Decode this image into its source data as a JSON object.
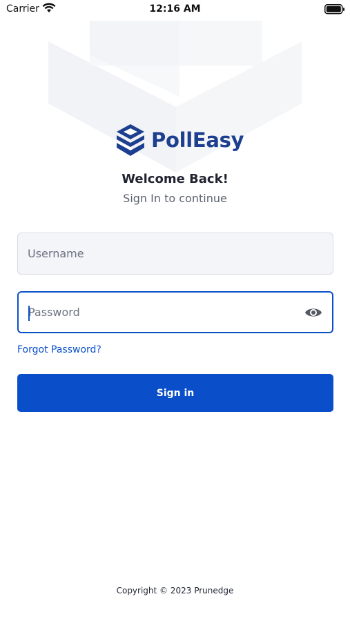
{
  "status_bar": {
    "carrier": "Carrier",
    "time": "12:16 AM",
    "wifi_icon": "wifi-icon",
    "battery_icon": "battery-icon"
  },
  "brand": {
    "name": "PollEasy",
    "logo_icon": "polleasy-logo-icon",
    "color": "#1d3f8f"
  },
  "header": {
    "title": "Welcome Back!",
    "subtitle": "Sign In to continue"
  },
  "form": {
    "username": {
      "placeholder": "Username",
      "value": ""
    },
    "password": {
      "placeholder": "Password",
      "value": "",
      "toggle_icon": "eye-icon"
    },
    "forgot_label": "Forgot Password?",
    "submit_label": "Sign in"
  },
  "footer": {
    "copyright": "Copyright © 2023 Prunedge"
  },
  "colors": {
    "accent": "#0a4fc9",
    "field_bg": "#f4f5f9",
    "background": "#ffffff"
  }
}
